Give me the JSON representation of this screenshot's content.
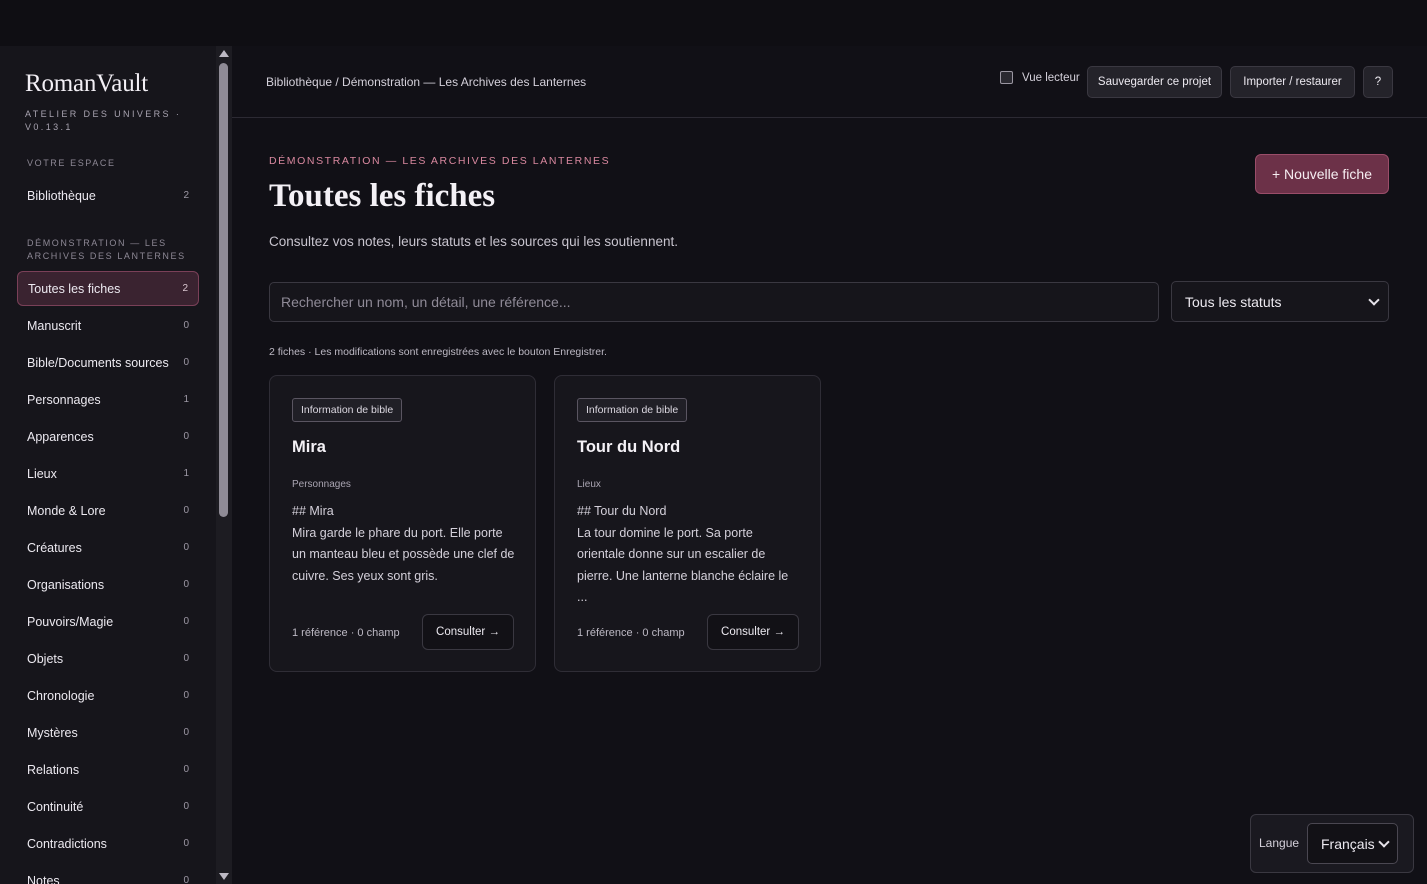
{
  "app": {
    "title": "RomanVault",
    "subtitle": "ATELIER DES UNIVERS · v0.13.1"
  },
  "sidebar": {
    "section_space": "VOTRE ESPACE",
    "library": {
      "label": "Bibliothèque",
      "count": "2"
    },
    "section_project": "DÉMONSTRATION — LES ARCHIVES DES LANTERNES",
    "items": [
      {
        "label": "Toutes les fiches",
        "count": "2",
        "active": true
      },
      {
        "label": "Manuscrit",
        "count": "0"
      },
      {
        "label": "Bible/Documents sources",
        "count": "0"
      },
      {
        "label": "Personnages",
        "count": "1"
      },
      {
        "label": "Apparences",
        "count": "0"
      },
      {
        "label": "Lieux",
        "count": "1"
      },
      {
        "label": "Monde & Lore",
        "count": "0"
      },
      {
        "label": "Créatures",
        "count": "0"
      },
      {
        "label": "Organisations",
        "count": "0"
      },
      {
        "label": "Pouvoirs/Magie",
        "count": "0"
      },
      {
        "label": "Objets",
        "count": "0"
      },
      {
        "label": "Chronologie",
        "count": "0"
      },
      {
        "label": "Mystères",
        "count": "0"
      },
      {
        "label": "Relations",
        "count": "0"
      },
      {
        "label": "Continuité",
        "count": "0"
      },
      {
        "label": "Contradictions",
        "count": "0"
      },
      {
        "label": "Notes",
        "count": "0"
      }
    ]
  },
  "header": {
    "breadcrumb": "Bibliothèque / Démonstration — Les Archives des Lanternes",
    "reader_view": "Vue lecteur",
    "save_project": "Sauvegarder ce projet",
    "import_restore": "Importer / restaurer",
    "help": "?"
  },
  "main": {
    "eyebrow": "DÉMONSTRATION — LES ARCHIVES DES LANTERNES",
    "title": "Toutes les fiches",
    "description": "Consultez vos notes, leurs statuts et les sources qui les soutiennent.",
    "new_button": "+ Nouvelle fiche",
    "search_placeholder": "Rechercher un nom, un détail, une référence...",
    "status_filter": "Tous les statuts",
    "meta": "2 fiches · Les modifications sont enregistrées avec le bouton Enregistrer."
  },
  "cards": [
    {
      "badge": "Information de bible",
      "title": "Mira",
      "category": "Personnages",
      "heading": "## Mira",
      "body": "Mira garde le phare du port. Elle porte un manteau bleu et possède une clef de cuivre. Ses yeux sont gris.",
      "footer": "1 référence · 0 champ",
      "button": "Consulter →"
    },
    {
      "badge": "Information de bible",
      "title": "Tour du Nord",
      "category": "Lieux",
      "heading": "## Tour du Nord",
      "body": "La tour domine le port. Sa porte orientale donne sur un escalier de pierre. Une lanterne blanche éclaire le ...",
      "footer": "1 référence · 0 champ",
      "button": "Consulter →"
    }
  ],
  "language": {
    "label": "Langue",
    "selected": "Français"
  }
}
